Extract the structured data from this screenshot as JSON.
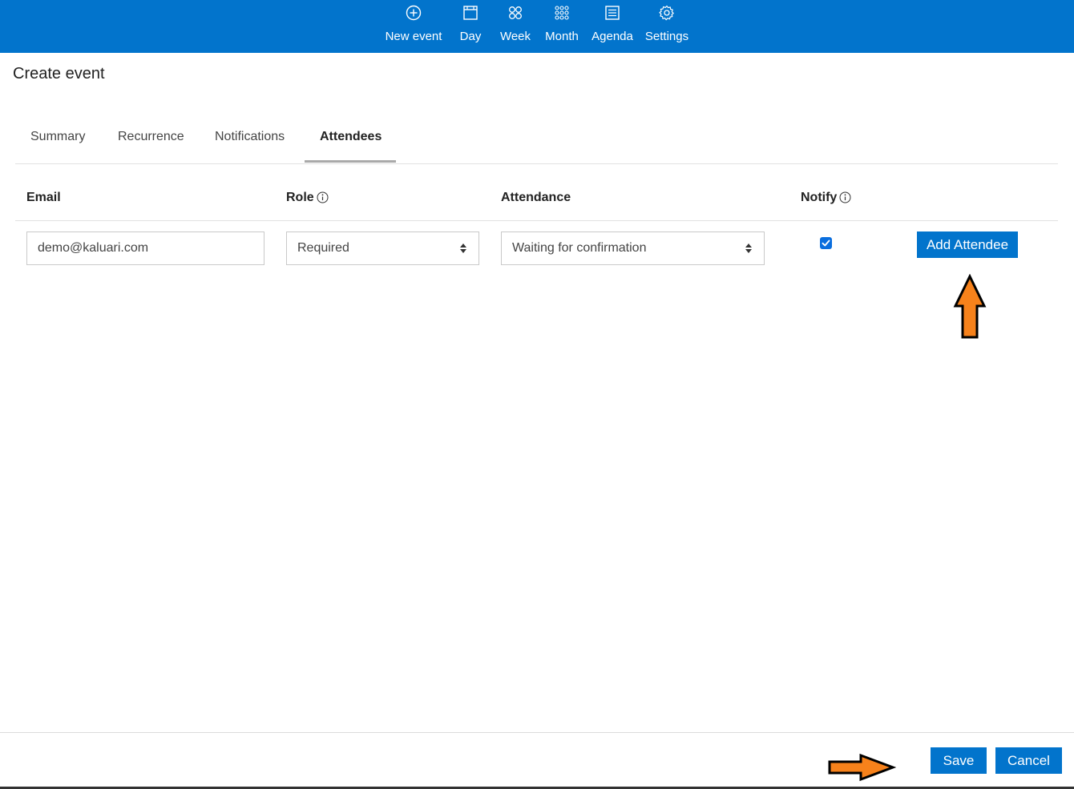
{
  "nav": {
    "items": [
      {
        "label": "New event",
        "icon": "plus-circle-icon"
      },
      {
        "label": "Day",
        "icon": "day-calendar-icon"
      },
      {
        "label": "Week",
        "icon": "week-grid-icon"
      },
      {
        "label": "Month",
        "icon": "month-grid-icon"
      },
      {
        "label": "Agenda",
        "icon": "agenda-list-icon"
      },
      {
        "label": "Settings",
        "icon": "gear-icon"
      }
    ]
  },
  "page": {
    "title": "Create event"
  },
  "tabs": [
    {
      "label": "Summary"
    },
    {
      "label": "Recurrence"
    },
    {
      "label": "Notifications"
    },
    {
      "label": "Attendees",
      "active": true
    }
  ],
  "table": {
    "headers": {
      "email": "Email",
      "role": "Role",
      "attendance": "Attendance",
      "notify": "Notify"
    },
    "row": {
      "email": "demo@kaluari.com",
      "role": "Required",
      "attendance": "Waiting for confirmation",
      "notify": true
    },
    "add_button": "Add Attendee"
  },
  "footer": {
    "save_label": "Save",
    "cancel_label": "Cancel"
  },
  "colors": {
    "brand": "#0274cc",
    "annotation_arrow": "#f7821b"
  }
}
